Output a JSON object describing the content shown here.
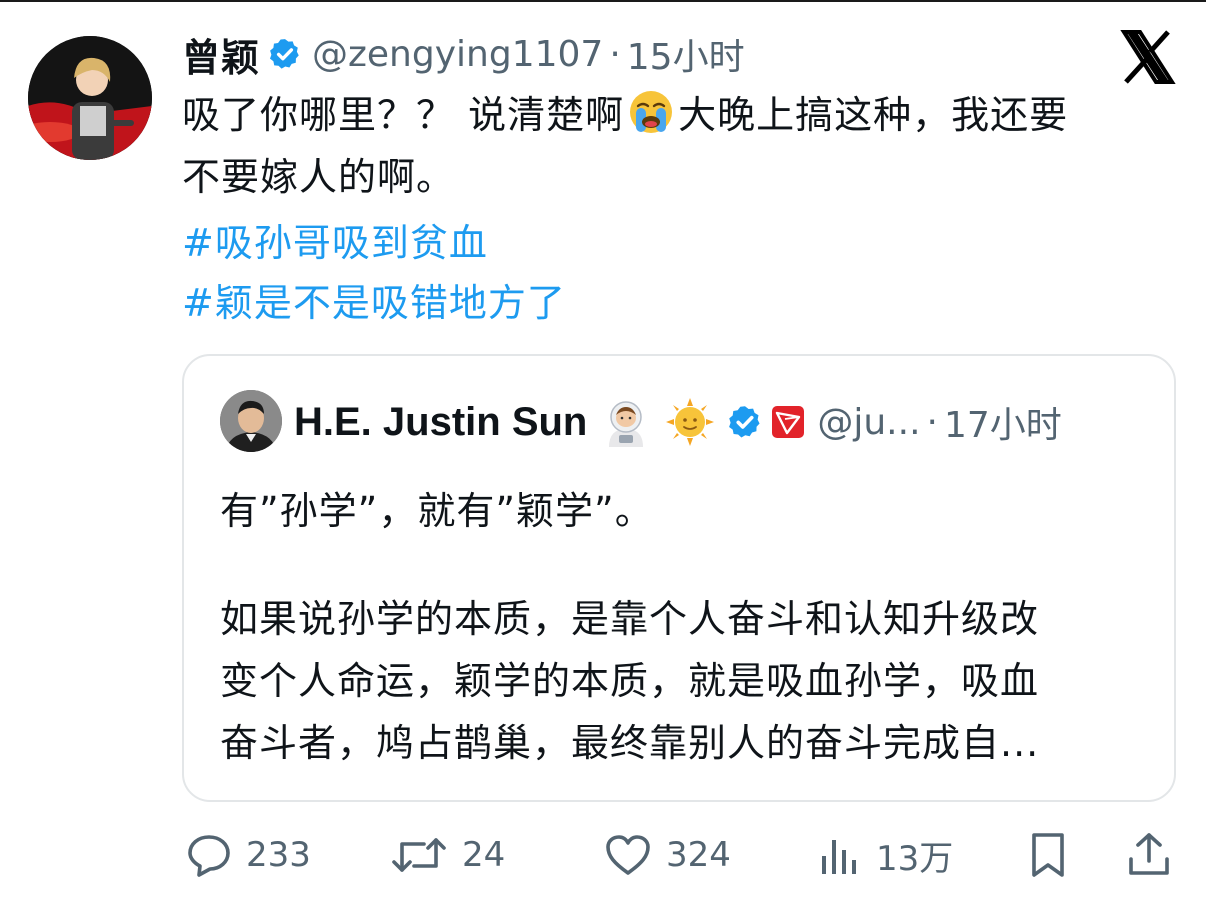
{
  "tweet": {
    "author": {
      "display_name": "曾颖",
      "handle": "@zengying1107",
      "verified": true
    },
    "separator": "·",
    "time": "15小时",
    "text_line1_a": "吸了你哪里？？ 说清楚啊",
    "text_line1_b": "大晚上搞这种，我还要",
    "text_line2": "不要嫁人的啊。",
    "hashtags": [
      "#吸孙哥吸到贫血",
      "#颖是不是吸错地方了"
    ],
    "emoji": "loudly-crying-face"
  },
  "quote": {
    "author": {
      "display_name": "H.E. Justin Sun",
      "handle": "@ju...",
      "verified": true
    },
    "separator": "·",
    "time": "17小时",
    "line1": "有”孙学”，就有”颖学”。",
    "body_lines": [
      "如果说孙学的本质，是靠个人奋斗和认知升级改",
      "变个人命运，颖学的本质，就是吸血孙学，吸血",
      "奋斗者，鸠占鹊巢，最终靠别人的奋斗完成自..."
    ]
  },
  "actions": {
    "replies": "233",
    "retweets": "24",
    "likes": "324",
    "views": "13万"
  },
  "colors": {
    "accent": "#1d9bf0",
    "muted": "#536471",
    "text": "#0f1419",
    "border": "#e3e6e8"
  },
  "icons": {
    "platform": "x-logo-icon",
    "reply": "speech-bubble-icon",
    "retweet": "retweet-arrows-icon",
    "like": "heart-icon",
    "views": "bar-chart-icon",
    "bookmark": "bookmark-icon",
    "share": "share-upload-icon"
  }
}
